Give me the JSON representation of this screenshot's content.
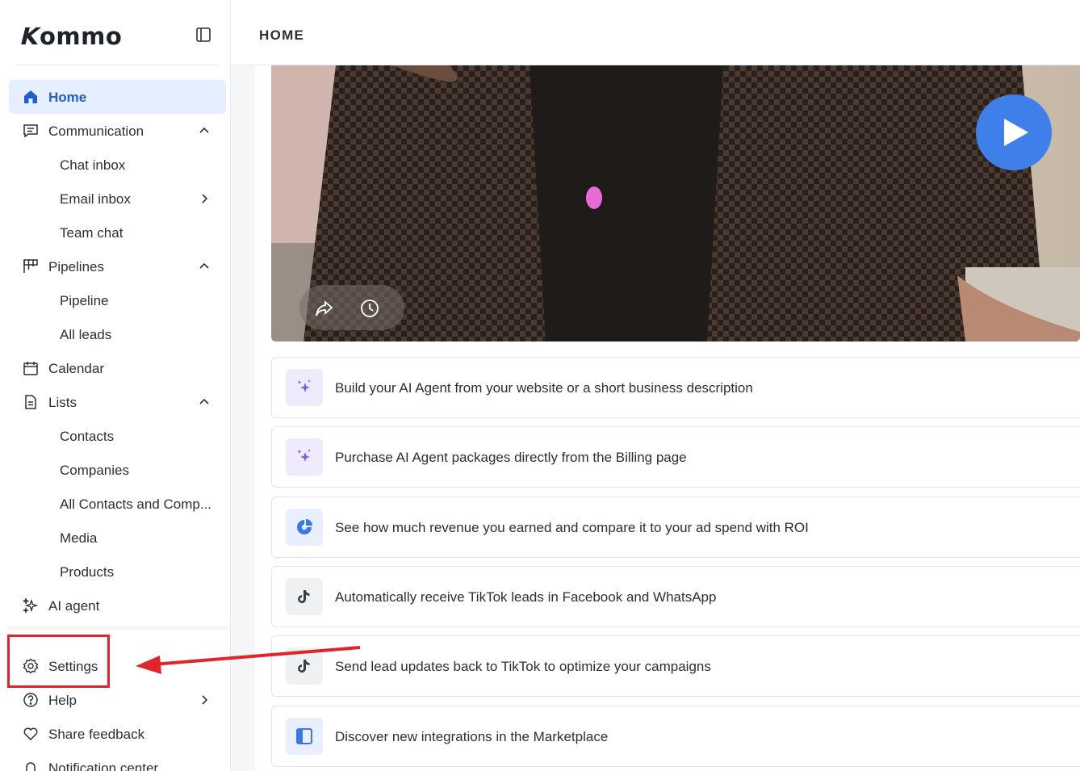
{
  "app": {
    "logo": "Kommo"
  },
  "header": {
    "title": "HOME"
  },
  "sidebar": {
    "items": [
      {
        "label": "Home",
        "icon": "home-icon",
        "active": true
      },
      {
        "label": "Communication",
        "icon": "chat-icon",
        "chevron": "up"
      },
      {
        "label": "Chat inbox",
        "sub": true
      },
      {
        "label": "Email inbox",
        "sub": true,
        "chevron": "right"
      },
      {
        "label": "Team chat",
        "sub": true
      },
      {
        "label": "Pipelines",
        "icon": "pipeline-icon",
        "chevron": "up"
      },
      {
        "label": "Pipeline",
        "sub": true
      },
      {
        "label": "All leads",
        "sub": true
      },
      {
        "label": "Calendar",
        "icon": "calendar-icon"
      },
      {
        "label": "Lists",
        "icon": "list-icon",
        "chevron": "up"
      },
      {
        "label": "Contacts",
        "sub": true
      },
      {
        "label": "Companies",
        "sub": true
      },
      {
        "label": "All Contacts and Comp...",
        "sub": true
      },
      {
        "label": "Media",
        "sub": true
      },
      {
        "label": "Products",
        "sub": true
      },
      {
        "label": "AI agent",
        "icon": "sparkle-icon"
      },
      {
        "label": "Settings",
        "icon": "gear-icon"
      },
      {
        "label": "Help",
        "icon": "help-icon",
        "chevron": "right"
      },
      {
        "label": "Share feedback",
        "icon": "heart-icon"
      },
      {
        "label": "Notification center",
        "icon": "bell-icon"
      }
    ]
  },
  "cards": [
    {
      "text": "Build your AI Agent from your website or a short business description",
      "icon": "sparkle-icon",
      "badge_color": "#efeafc",
      "icon_color": "#7a5cf0"
    },
    {
      "text": "Purchase AI Agent packages directly from the Billing page",
      "icon": "sparkle-icon",
      "badge_color": "#efeafc",
      "icon_color": "#7a5cf0"
    },
    {
      "text": "See how much revenue you earned and compare it to your ad spend with ROI",
      "icon": "pie-chart-icon",
      "badge_color": "#e8f0ff",
      "icon_color": "#3a78e8"
    },
    {
      "text": "Automatically receive TikTok leads in Facebook and WhatsApp",
      "icon": "tiktok-icon",
      "badge_color": "#f0f1f3",
      "icon_color": "#3b3f46"
    },
    {
      "text": "Send lead updates back to TikTok to optimize your campaigns",
      "icon": "tiktok-icon",
      "badge_color": "#f0f1f3",
      "icon_color": "#3b3f46"
    },
    {
      "text": "Discover new integrations in the Marketplace",
      "icon": "marketplace-icon",
      "badge_color": "#e8f0ff",
      "icon_color": "#3a78e8"
    }
  ],
  "colors": {
    "accent": "#1f5fd1",
    "active_bg": "#e6efff",
    "annotation": "#e0242a",
    "play": "#3f7fe9"
  }
}
